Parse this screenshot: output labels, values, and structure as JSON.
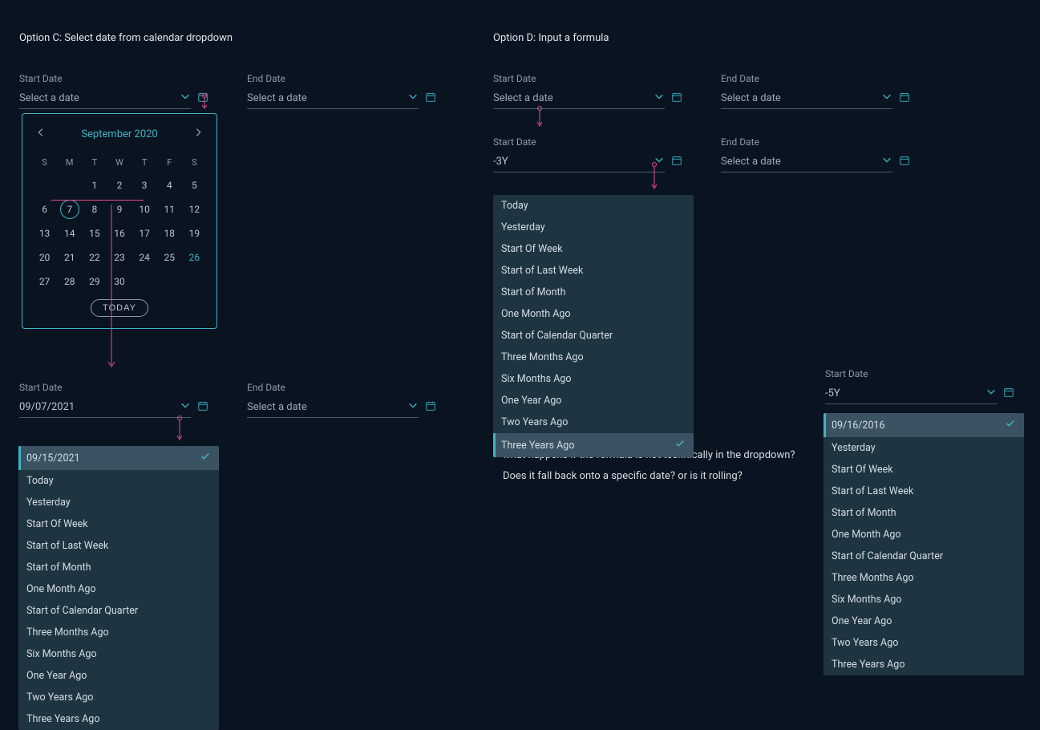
{
  "optionC": {
    "title": "Option C: Select date from calendar dropdown",
    "start": {
      "label": "Start Date",
      "value": "Select a date"
    },
    "end": {
      "label": "End Date",
      "value": "Select a date"
    },
    "start2": {
      "label": "Start Date",
      "value": "09/07/2021"
    },
    "end2": {
      "label": "End Date",
      "value": "Select a date"
    }
  },
  "optionD": {
    "title": "Option D: Input a formula",
    "start": {
      "label": "Start Date",
      "value": "Select a date"
    },
    "end": {
      "label": "End Date",
      "value": "Select a date"
    },
    "start2": {
      "label": "Start Date",
      "value": "-3Y"
    },
    "end2": {
      "label": "End Date",
      "value": "Select a date"
    },
    "question1": "what happens if the formula is not technically in the dropdown?",
    "question2": "Does it fall back onto a specific date? or is it rolling?"
  },
  "lone": {
    "label": "Start Date",
    "value": "-5Y"
  },
  "calendar": {
    "month": "September 2020",
    "dow": [
      "S",
      "M",
      "T",
      "W",
      "T",
      "F",
      "S"
    ],
    "leading_blanks": 2,
    "days": 30,
    "today": 7,
    "highlight": 26,
    "today_label": "TODAY"
  },
  "dropdown_common": [
    "Yesterday",
    "Start Of Week",
    "Start of Last Week",
    "Start of Month",
    "One Month Ago",
    "Start of Calendar Quarter",
    "Three Months Ago",
    "Six Months Ago",
    "One Year Ago",
    "Two Years Ago",
    "Three Years Ago"
  ],
  "ddC": {
    "selected": "09/15/2021",
    "second": "Today"
  },
  "ddD": {
    "selected": "Three Years Ago",
    "first": "Today"
  },
  "ddLone": {
    "selected": "09/16/2016"
  }
}
